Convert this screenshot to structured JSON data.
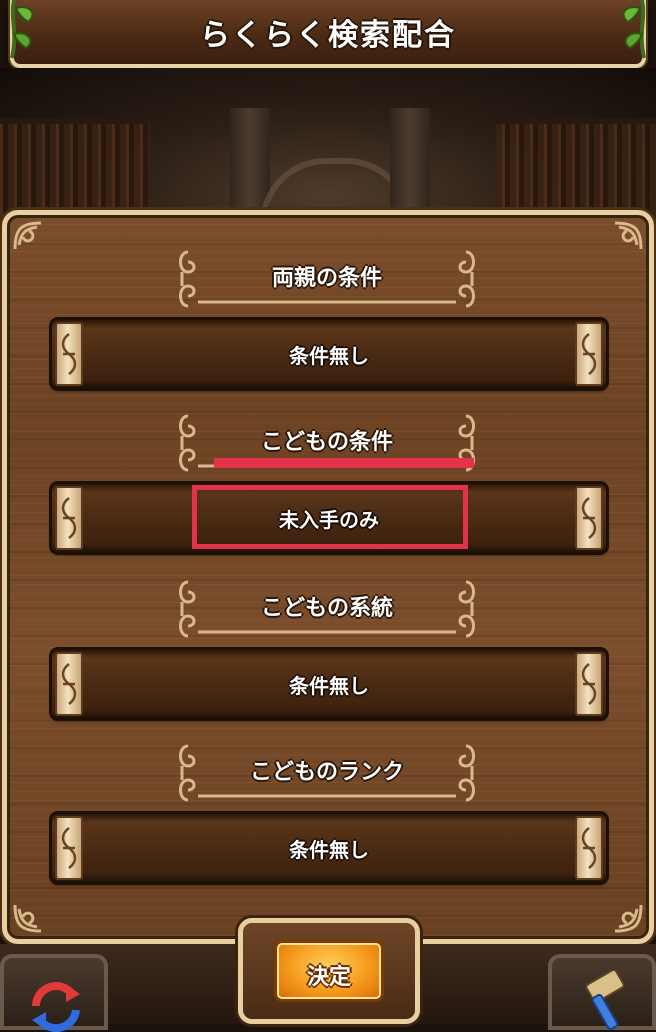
{
  "title": "らくらく検索配合",
  "sections": [
    {
      "header": "両親の条件",
      "value": "条件無し"
    },
    {
      "header": "こどもの条件",
      "value": "未入手のみ"
    },
    {
      "header": "こどもの系統",
      "value": "条件無し"
    },
    {
      "header": "こどものランク",
      "value": "条件無し"
    }
  ],
  "confirm_label": "決定",
  "icons": {
    "reset": "refresh-arrows-icon",
    "tool": "hammer-tool-icon"
  },
  "colors": {
    "highlight": "#e2334a",
    "frame": "#e7cfa0",
    "button": "#f59a1c"
  }
}
